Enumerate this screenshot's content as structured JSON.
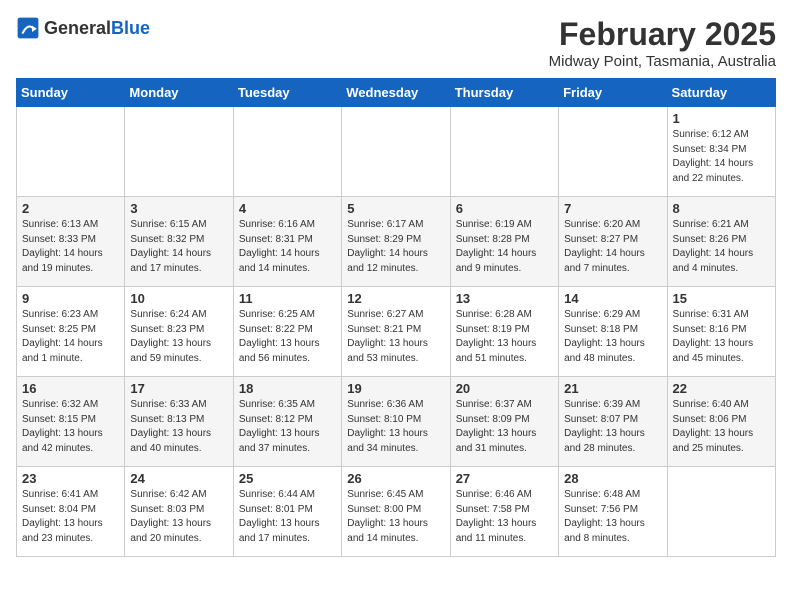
{
  "header": {
    "logo_general": "General",
    "logo_blue": "Blue",
    "month_year": "February 2025",
    "location": "Midway Point, Tasmania, Australia"
  },
  "days_of_week": [
    "Sunday",
    "Monday",
    "Tuesday",
    "Wednesday",
    "Thursday",
    "Friday",
    "Saturday"
  ],
  "weeks": [
    [
      {
        "day": "",
        "info": ""
      },
      {
        "day": "",
        "info": ""
      },
      {
        "day": "",
        "info": ""
      },
      {
        "day": "",
        "info": ""
      },
      {
        "day": "",
        "info": ""
      },
      {
        "day": "",
        "info": ""
      },
      {
        "day": "1",
        "info": "Sunrise: 6:12 AM\nSunset: 8:34 PM\nDaylight: 14 hours\nand 22 minutes."
      }
    ],
    [
      {
        "day": "2",
        "info": "Sunrise: 6:13 AM\nSunset: 8:33 PM\nDaylight: 14 hours\nand 19 minutes."
      },
      {
        "day": "3",
        "info": "Sunrise: 6:15 AM\nSunset: 8:32 PM\nDaylight: 14 hours\nand 17 minutes."
      },
      {
        "day": "4",
        "info": "Sunrise: 6:16 AM\nSunset: 8:31 PM\nDaylight: 14 hours\nand 14 minutes."
      },
      {
        "day": "5",
        "info": "Sunrise: 6:17 AM\nSunset: 8:29 PM\nDaylight: 14 hours\nand 12 minutes."
      },
      {
        "day": "6",
        "info": "Sunrise: 6:19 AM\nSunset: 8:28 PM\nDaylight: 14 hours\nand 9 minutes."
      },
      {
        "day": "7",
        "info": "Sunrise: 6:20 AM\nSunset: 8:27 PM\nDaylight: 14 hours\nand 7 minutes."
      },
      {
        "day": "8",
        "info": "Sunrise: 6:21 AM\nSunset: 8:26 PM\nDaylight: 14 hours\nand 4 minutes."
      }
    ],
    [
      {
        "day": "9",
        "info": "Sunrise: 6:23 AM\nSunset: 8:25 PM\nDaylight: 14 hours\nand 1 minute."
      },
      {
        "day": "10",
        "info": "Sunrise: 6:24 AM\nSunset: 8:23 PM\nDaylight: 13 hours\nand 59 minutes."
      },
      {
        "day": "11",
        "info": "Sunrise: 6:25 AM\nSunset: 8:22 PM\nDaylight: 13 hours\nand 56 minutes."
      },
      {
        "day": "12",
        "info": "Sunrise: 6:27 AM\nSunset: 8:21 PM\nDaylight: 13 hours\nand 53 minutes."
      },
      {
        "day": "13",
        "info": "Sunrise: 6:28 AM\nSunset: 8:19 PM\nDaylight: 13 hours\nand 51 minutes."
      },
      {
        "day": "14",
        "info": "Sunrise: 6:29 AM\nSunset: 8:18 PM\nDaylight: 13 hours\nand 48 minutes."
      },
      {
        "day": "15",
        "info": "Sunrise: 6:31 AM\nSunset: 8:16 PM\nDaylight: 13 hours\nand 45 minutes."
      }
    ],
    [
      {
        "day": "16",
        "info": "Sunrise: 6:32 AM\nSunset: 8:15 PM\nDaylight: 13 hours\nand 42 minutes."
      },
      {
        "day": "17",
        "info": "Sunrise: 6:33 AM\nSunset: 8:13 PM\nDaylight: 13 hours\nand 40 minutes."
      },
      {
        "day": "18",
        "info": "Sunrise: 6:35 AM\nSunset: 8:12 PM\nDaylight: 13 hours\nand 37 minutes."
      },
      {
        "day": "19",
        "info": "Sunrise: 6:36 AM\nSunset: 8:10 PM\nDaylight: 13 hours\nand 34 minutes."
      },
      {
        "day": "20",
        "info": "Sunrise: 6:37 AM\nSunset: 8:09 PM\nDaylight: 13 hours\nand 31 minutes."
      },
      {
        "day": "21",
        "info": "Sunrise: 6:39 AM\nSunset: 8:07 PM\nDaylight: 13 hours\nand 28 minutes."
      },
      {
        "day": "22",
        "info": "Sunrise: 6:40 AM\nSunset: 8:06 PM\nDaylight: 13 hours\nand 25 minutes."
      }
    ],
    [
      {
        "day": "23",
        "info": "Sunrise: 6:41 AM\nSunset: 8:04 PM\nDaylight: 13 hours\nand 23 minutes."
      },
      {
        "day": "24",
        "info": "Sunrise: 6:42 AM\nSunset: 8:03 PM\nDaylight: 13 hours\nand 20 minutes."
      },
      {
        "day": "25",
        "info": "Sunrise: 6:44 AM\nSunset: 8:01 PM\nDaylight: 13 hours\nand 17 minutes."
      },
      {
        "day": "26",
        "info": "Sunrise: 6:45 AM\nSunset: 8:00 PM\nDaylight: 13 hours\nand 14 minutes."
      },
      {
        "day": "27",
        "info": "Sunrise: 6:46 AM\nSunset: 7:58 PM\nDaylight: 13 hours\nand 11 minutes."
      },
      {
        "day": "28",
        "info": "Sunrise: 6:48 AM\nSunset: 7:56 PM\nDaylight: 13 hours\nand 8 minutes."
      },
      {
        "day": "",
        "info": ""
      }
    ]
  ]
}
